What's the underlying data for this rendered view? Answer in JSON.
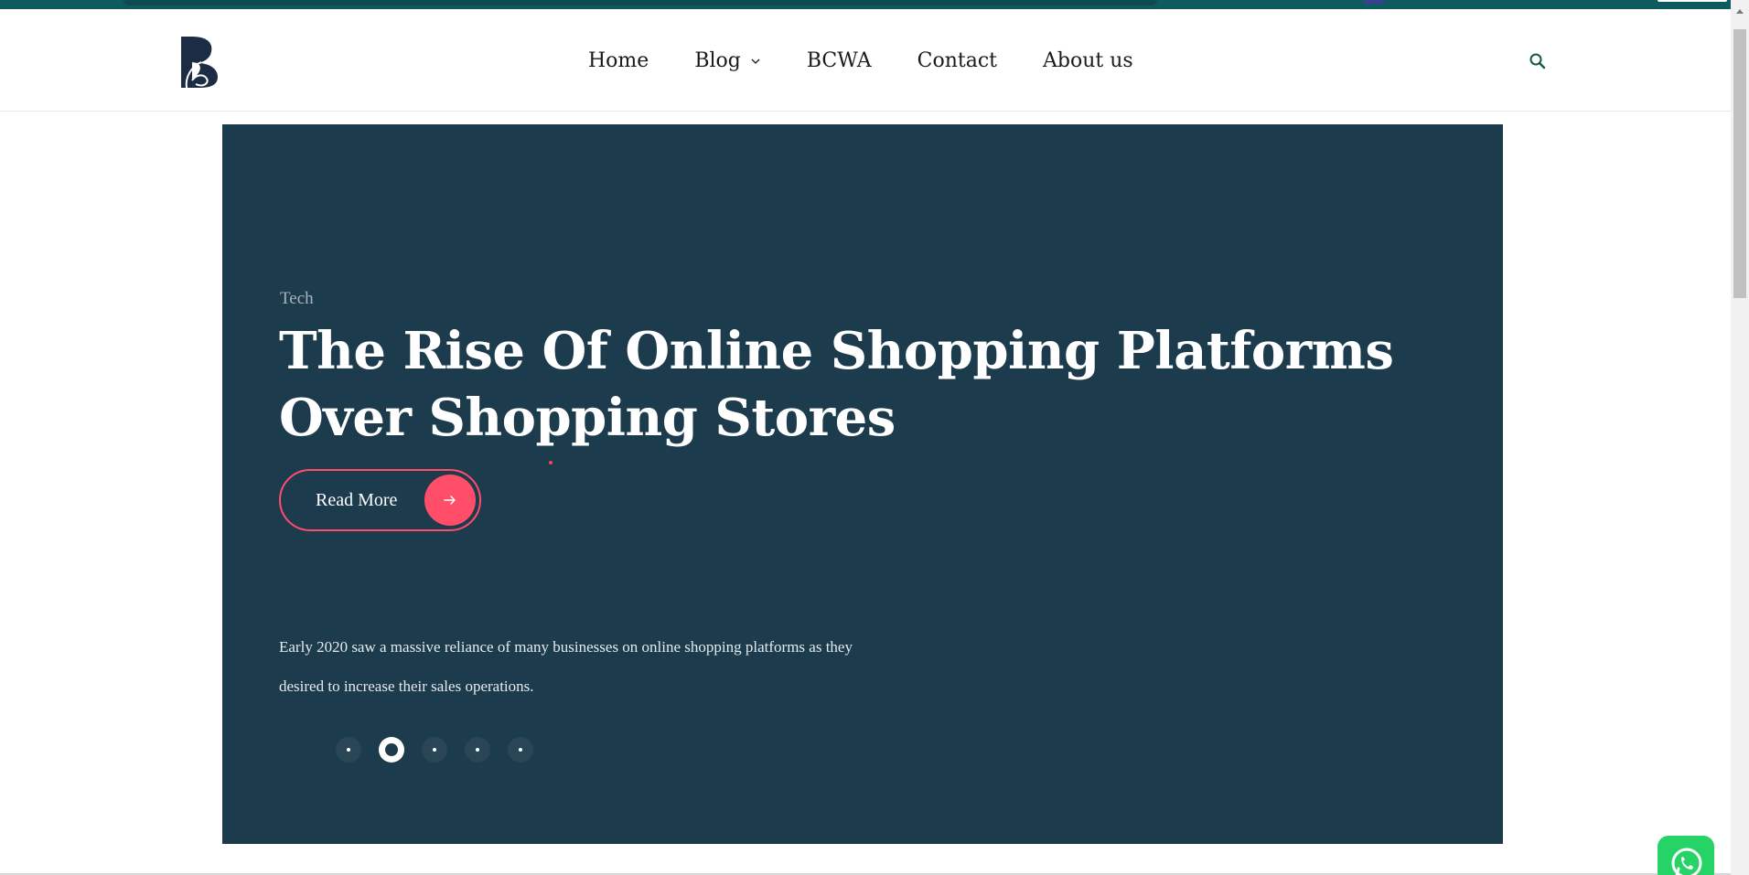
{
  "site": {
    "logo_icon": "b-monogram-logo-icon",
    "brand_color": "#1c3b4d",
    "accent_color": "#ff4d6a"
  },
  "nav": {
    "items": [
      {
        "label": "Home"
      },
      {
        "label": "Blog",
        "has_dropdown": true
      },
      {
        "label": "BCWA"
      },
      {
        "label": "Contact"
      },
      {
        "label": "About us"
      }
    ],
    "search_icon": "search-icon"
  },
  "hero": {
    "category": "Tech",
    "title": "The Rise Of Online Shopping Platforms Over Shopping Stores",
    "read_more_label": "Read More",
    "excerpt": "Early 2020 saw a massive reliance of many businesses on online shopping platforms as they desired to increase their sales operations.",
    "slides_total": 5,
    "active_slide": 2
  },
  "floating": {
    "whatsapp_icon": "whatsapp-icon"
  }
}
